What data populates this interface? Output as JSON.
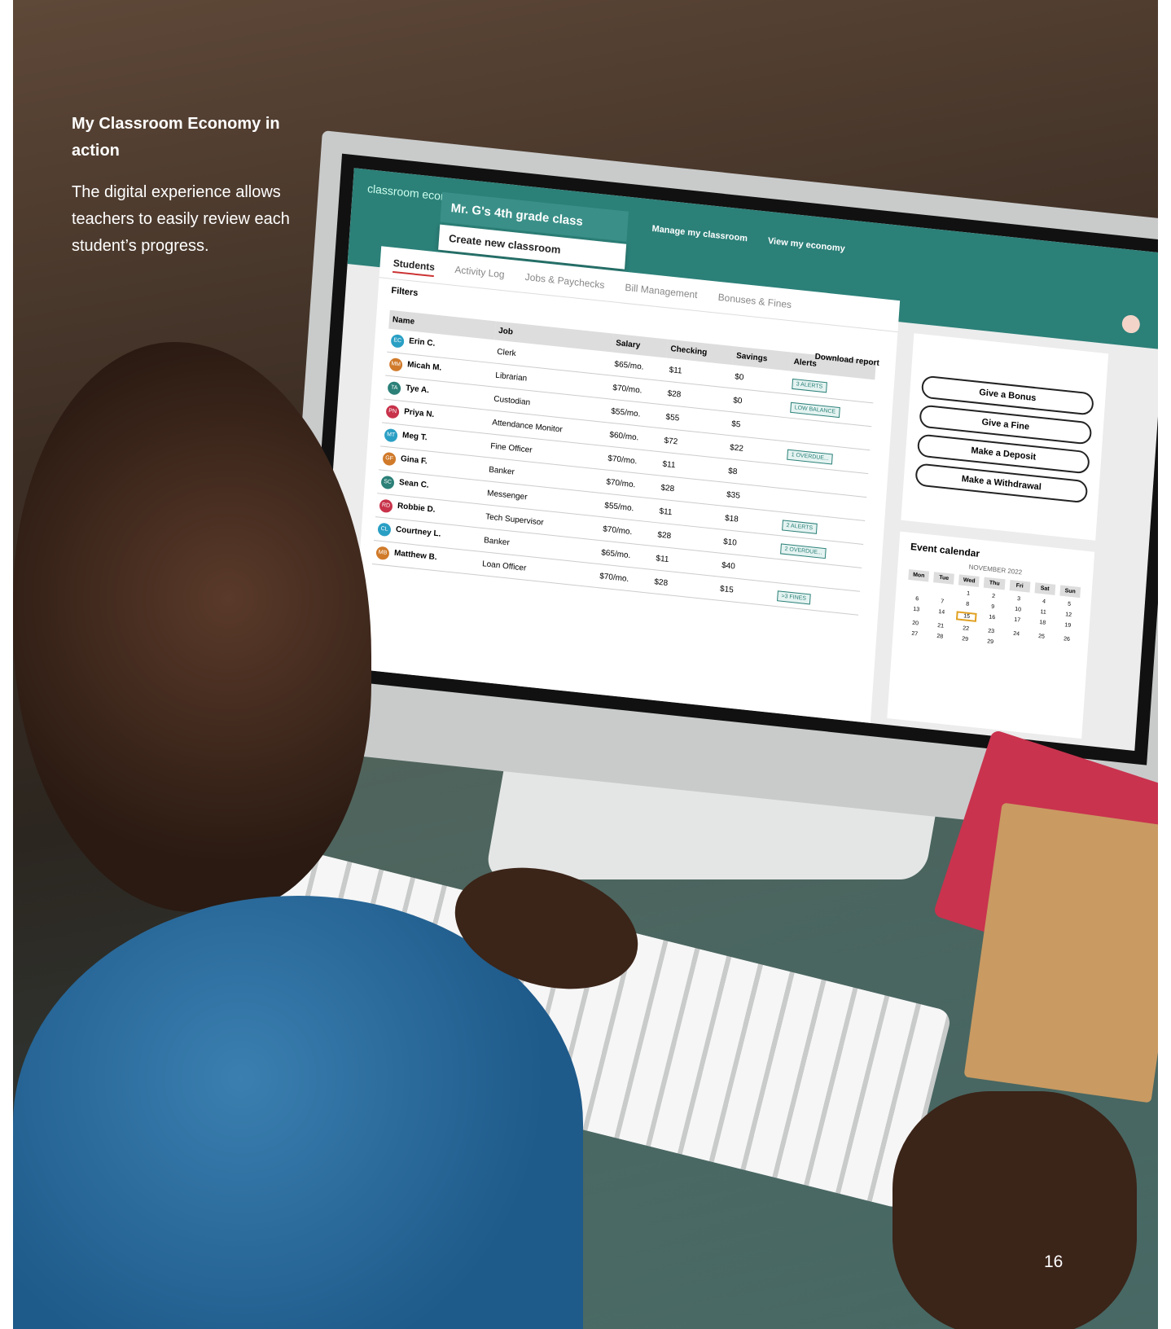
{
  "caption": {
    "title": "My Classroom Economy in action",
    "body": "The digital experience allows teachers to easily review each student’s progress."
  },
  "page_number": "16",
  "app": {
    "logo": "classroom economy",
    "class_name": "Mr. G's 4th grade class",
    "create_classroom": "Create new classroom",
    "top_links": [
      "Manage my classroom",
      "View my economy"
    ],
    "tabs": [
      "Students",
      "Activity Log",
      "Jobs & Paychecks",
      "Bill Management",
      "Bonuses & Fines"
    ],
    "filters": "Filters",
    "download": "Download report",
    "columns": [
      "Name",
      "Job",
      "Salary",
      "Checking",
      "Savings",
      "Alerts"
    ],
    "rows": [
      {
        "init": "EC",
        "name": "Erin C.",
        "job": "Clerk",
        "salary": "$65/mo.",
        "checking": "$11",
        "savings": "$0",
        "alert": "3 ALERTS",
        "color": "#2a9fc4"
      },
      {
        "init": "MM",
        "name": "Micah M.",
        "job": "Librarian",
        "salary": "$70/mo.",
        "checking": "$28",
        "savings": "$0",
        "alert": "LOW BALANCE",
        "color": "#d07a2a"
      },
      {
        "init": "TA",
        "name": "Tye A.",
        "job": "Custodian",
        "salary": "$55/mo.",
        "checking": "$55",
        "savings": "$5",
        "alert": "",
        "color": "#2b8078"
      },
      {
        "init": "PN",
        "name": "Priya N.",
        "job": "Attendance Monitor",
        "salary": "$60/mo.",
        "checking": "$72",
        "savings": "$22",
        "alert": "1 OVERDUE...",
        "color": "#c8324a"
      },
      {
        "init": "MT",
        "name": "Meg T.",
        "job": "Fine Officer",
        "salary": "$70/mo.",
        "checking": "$11",
        "savings": "$8",
        "alert": "",
        "color": "#2a9fc4"
      },
      {
        "init": "GF",
        "name": "Gina F.",
        "job": "Banker",
        "salary": "$70/mo.",
        "checking": "$28",
        "savings": "$35",
        "alert": "",
        "color": "#d07a2a"
      },
      {
        "init": "SC",
        "name": "Sean C.",
        "job": "Messenger",
        "salary": "$55/mo.",
        "checking": "$11",
        "savings": "$18",
        "alert": "2 ALERTS",
        "color": "#2b8078"
      },
      {
        "init": "RD",
        "name": "Robbie D.",
        "job": "Tech Supervisor",
        "salary": "$70/mo.",
        "checking": "$28",
        "savings": "$10",
        "alert": "2 OVERDUE...",
        "color": "#c8324a"
      },
      {
        "init": "CL",
        "name": "Courtney L.",
        "job": "Banker",
        "salary": "$65/mo.",
        "checking": "$11",
        "savings": "$40",
        "alert": "",
        "color": "#2a9fc4"
      },
      {
        "init": "MB",
        "name": "Matthew B.",
        "job": "Loan Officer",
        "salary": "$70/mo.",
        "checking": "$28",
        "savings": "$15",
        "alert": ">3 FINES",
        "color": "#d07a2a"
      }
    ],
    "actions": [
      "Give a Bonus",
      "Give a Fine",
      "Make a Deposit",
      "Make a Withdrawal"
    ],
    "calendar": {
      "title": "Event calendar",
      "month": "NOVEMBER 2022",
      "weekdays": [
        "Mon",
        "Tue",
        "Wed",
        "Thu",
        "Fri",
        "Sat",
        "Sun"
      ],
      "days": [
        "",
        "",
        "1",
        "2",
        "3",
        "4",
        "5",
        "6",
        "7",
        "8",
        "9",
        "10",
        "11",
        "12",
        "13",
        "14",
        "15",
        "16",
        "17",
        "18",
        "19",
        "20",
        "21",
        "22",
        "23",
        "24",
        "25",
        "26",
        "27",
        "28",
        "29",
        "29"
      ]
    }
  }
}
